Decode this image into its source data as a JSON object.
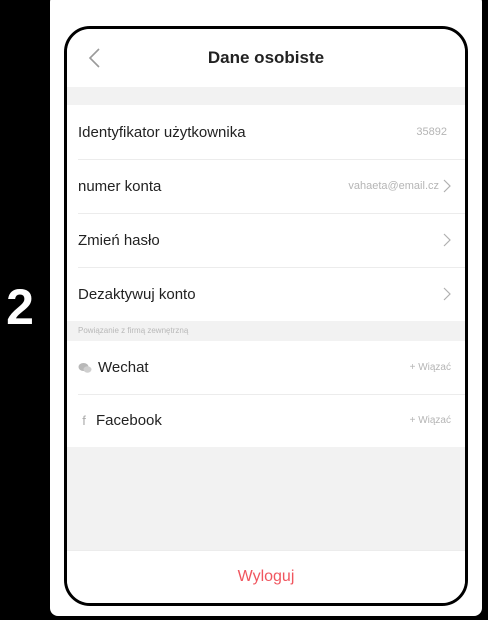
{
  "step": "2",
  "header": {
    "title": "Dane osobiste",
    "back_icon": "chevron-left-icon"
  },
  "rows": [
    {
      "label": "Identyfikator użytkownika",
      "value": "35892"
    },
    {
      "label": "numer konta",
      "value": "vahaeta@email.cz"
    },
    {
      "label": "Zmień hasło"
    },
    {
      "label": "Dezaktywuj konto"
    }
  ],
  "third_party": {
    "section_label": "Powiązanie z firmą zewnętrzną",
    "items": [
      {
        "label": "Wechat",
        "action": "+ Wiązać",
        "icon": "wechat-icon"
      },
      {
        "label": "Facebook",
        "action": "+ Wiązać",
        "icon": "facebook-icon",
        "glyph": "f"
      }
    ]
  },
  "logout": {
    "label": "Wyloguj",
    "color": "#f0565f"
  }
}
